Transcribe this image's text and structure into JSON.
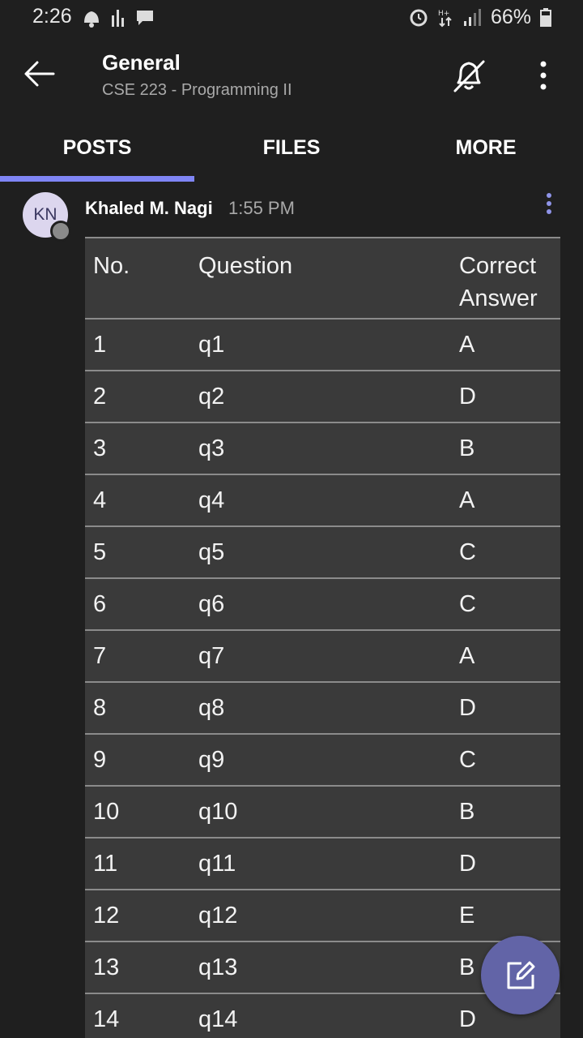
{
  "status_bar": {
    "time": "2:26",
    "battery": "66%",
    "icons": [
      "notification-icon",
      "bars-icon",
      "chat-bubble-icon",
      "alarm-icon",
      "data-icon",
      "signal-icon",
      "battery-icon"
    ]
  },
  "header": {
    "title": "General",
    "subtitle": "CSE 223 - Programming II",
    "icons": [
      "back-arrow-icon",
      "bell-off-icon",
      "more-vertical-icon"
    ]
  },
  "tabs": [
    {
      "label": "POSTS",
      "selected": true
    },
    {
      "label": "FILES",
      "selected": false
    },
    {
      "label": "MORE",
      "selected": false
    }
  ],
  "post": {
    "avatar_initials": "KN",
    "author": "Khaled M. Nagi",
    "time": "1:55 PM",
    "table": {
      "headers": [
        "No.",
        "Question",
        "Correct\nAnswer"
      ],
      "rows": [
        [
          "1",
          "q1",
          "A"
        ],
        [
          "2",
          "q2",
          "D"
        ],
        [
          "3",
          "q3",
          "B"
        ],
        [
          "4",
          "q4",
          "A"
        ],
        [
          "5",
          "q5",
          "C"
        ],
        [
          "6",
          "q6",
          "C"
        ],
        [
          "7",
          "q7",
          "A"
        ],
        [
          "8",
          "q8",
          "D"
        ],
        [
          "9",
          "q9",
          "C"
        ],
        [
          "10",
          "q10",
          "B"
        ],
        [
          "11",
          "q11",
          "D"
        ],
        [
          "12",
          "q12",
          "E"
        ],
        [
          "13",
          "q13",
          "B"
        ],
        [
          "14",
          "q14",
          "D"
        ]
      ]
    }
  },
  "colors": {
    "accent": "#7f85f5",
    "fab": "#6264a7",
    "background": "#1f1f1f",
    "table_background": "#3a3a3a"
  },
  "fab": {
    "icon": "compose-icon"
  }
}
